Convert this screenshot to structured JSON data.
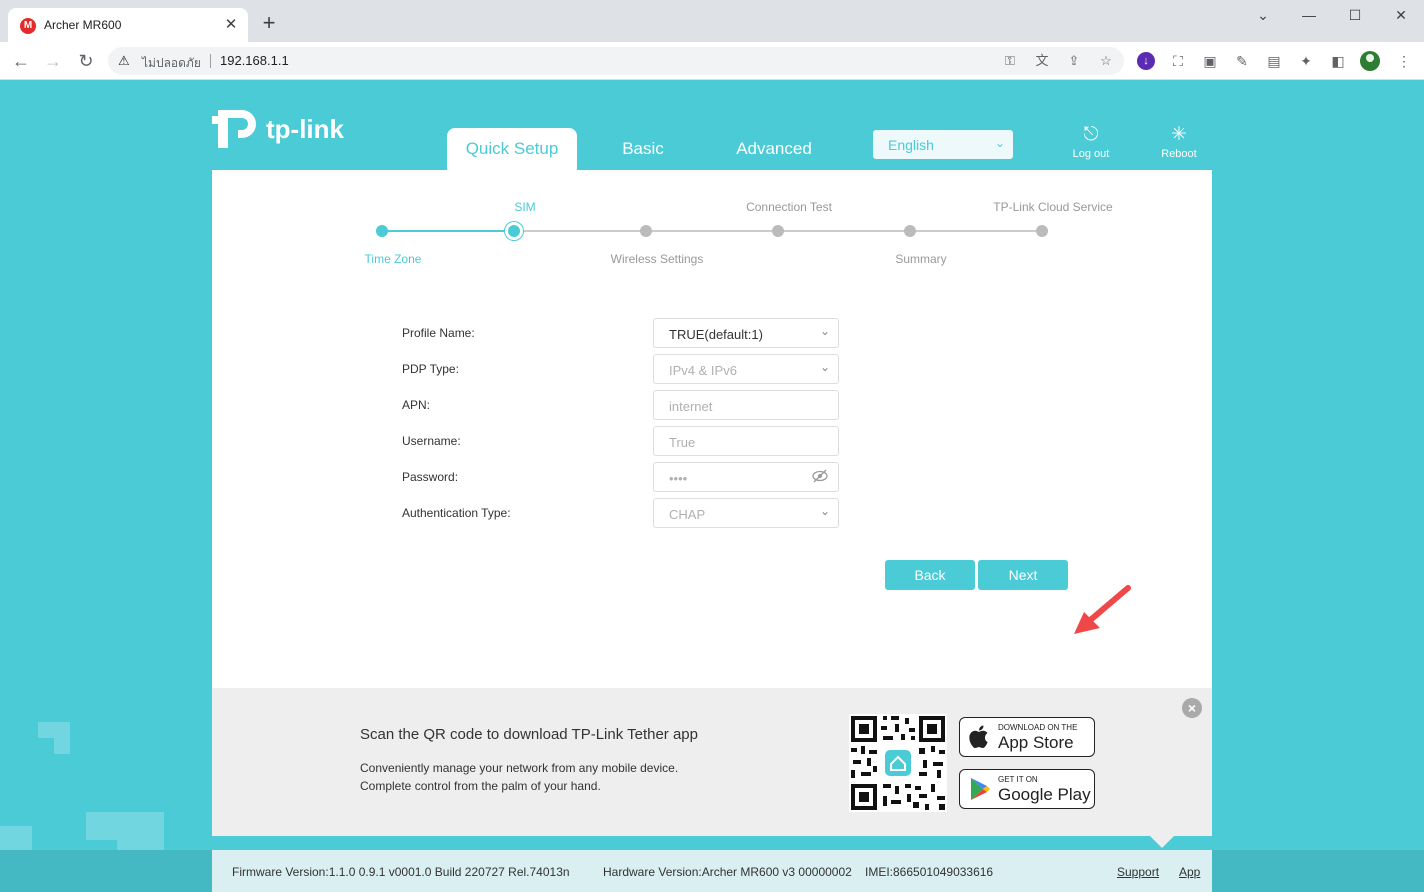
{
  "browser": {
    "tab_title": "Archer MR600",
    "favicon_letter": "M",
    "insecure_label": "ไม่ปลอดภัย",
    "url": "192.168.1.1"
  },
  "header": {
    "brand": "tp-link",
    "tabs": [
      {
        "label": "Quick Setup",
        "active": true
      },
      {
        "label": "Basic",
        "active": false
      },
      {
        "label": "Advanced",
        "active": false
      }
    ],
    "language": "English",
    "logout_label": "Log out",
    "reboot_label": "Reboot"
  },
  "stepper": {
    "steps": [
      "Time Zone",
      "SIM",
      "Wireless Settings",
      "Connection Test",
      "Summary",
      "TP-Link Cloud Service"
    ],
    "current_index": 1
  },
  "form": {
    "profile_name_label": "Profile Name:",
    "profile_name_value": "TRUE(default:1)",
    "pdp_type_label": "PDP Type:",
    "pdp_type_value": "IPv4 & IPv6",
    "apn_label": "APN:",
    "apn_value": "internet",
    "username_label": "Username:",
    "username_value": "True",
    "password_label": "Password:",
    "password_value": "••••",
    "auth_type_label": "Authentication Type:",
    "auth_type_value": "CHAP",
    "back_label": "Back",
    "next_label": "Next"
  },
  "promo": {
    "title": "Scan the QR code to download TP-Link Tether app",
    "line1": "Conveniently manage your network from any mobile device.",
    "line2": "Complete control from the palm of your hand.",
    "appstore_small": "DOWNLOAD ON THE",
    "appstore_big": "App Store",
    "googleplay_small": "GET IT ON",
    "googleplay_big": "Google Play"
  },
  "footer": {
    "firmware": "Firmware Version:1.1.0 0.9.1 v0001.0 Build 220727 Rel.74013n",
    "hardware": "Hardware Version:Archer MR600 v3 00000002",
    "imei": "IMEI:866501049033616",
    "support_label": "Support",
    "app_label": "App"
  },
  "colors": {
    "accent": "#4acbd6",
    "annotation_arrow": "#f04848"
  }
}
